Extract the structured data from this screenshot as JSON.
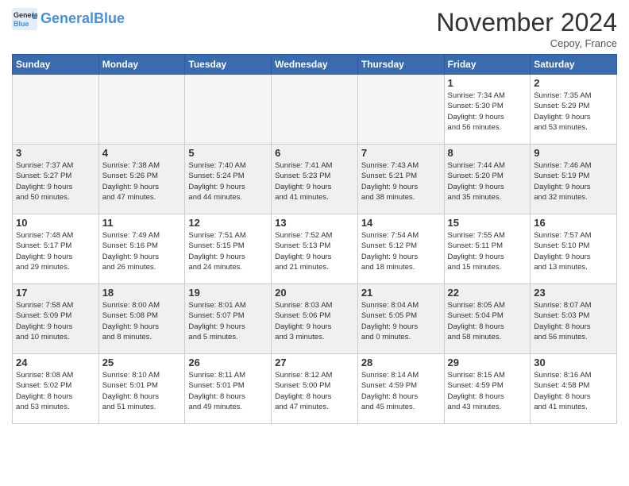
{
  "header": {
    "logo_general": "General",
    "logo_blue": "Blue",
    "month": "November 2024",
    "location": "Cepoy, France"
  },
  "weekdays": [
    "Sunday",
    "Monday",
    "Tuesday",
    "Wednesday",
    "Thursday",
    "Friday",
    "Saturday"
  ],
  "weeks": [
    [
      {
        "day": "",
        "info": ""
      },
      {
        "day": "",
        "info": ""
      },
      {
        "day": "",
        "info": ""
      },
      {
        "day": "",
        "info": ""
      },
      {
        "day": "",
        "info": ""
      },
      {
        "day": "1",
        "info": "Sunrise: 7:34 AM\nSunset: 5:30 PM\nDaylight: 9 hours\nand 56 minutes."
      },
      {
        "day": "2",
        "info": "Sunrise: 7:35 AM\nSunset: 5:29 PM\nDaylight: 9 hours\nand 53 minutes."
      }
    ],
    [
      {
        "day": "3",
        "info": "Sunrise: 7:37 AM\nSunset: 5:27 PM\nDaylight: 9 hours\nand 50 minutes."
      },
      {
        "day": "4",
        "info": "Sunrise: 7:38 AM\nSunset: 5:26 PM\nDaylight: 9 hours\nand 47 minutes."
      },
      {
        "day": "5",
        "info": "Sunrise: 7:40 AM\nSunset: 5:24 PM\nDaylight: 9 hours\nand 44 minutes."
      },
      {
        "day": "6",
        "info": "Sunrise: 7:41 AM\nSunset: 5:23 PM\nDaylight: 9 hours\nand 41 minutes."
      },
      {
        "day": "7",
        "info": "Sunrise: 7:43 AM\nSunset: 5:21 PM\nDaylight: 9 hours\nand 38 minutes."
      },
      {
        "day": "8",
        "info": "Sunrise: 7:44 AM\nSunset: 5:20 PM\nDaylight: 9 hours\nand 35 minutes."
      },
      {
        "day": "9",
        "info": "Sunrise: 7:46 AM\nSunset: 5:19 PM\nDaylight: 9 hours\nand 32 minutes."
      }
    ],
    [
      {
        "day": "10",
        "info": "Sunrise: 7:48 AM\nSunset: 5:17 PM\nDaylight: 9 hours\nand 29 minutes."
      },
      {
        "day": "11",
        "info": "Sunrise: 7:49 AM\nSunset: 5:16 PM\nDaylight: 9 hours\nand 26 minutes."
      },
      {
        "day": "12",
        "info": "Sunrise: 7:51 AM\nSunset: 5:15 PM\nDaylight: 9 hours\nand 24 minutes."
      },
      {
        "day": "13",
        "info": "Sunrise: 7:52 AM\nSunset: 5:13 PM\nDaylight: 9 hours\nand 21 minutes."
      },
      {
        "day": "14",
        "info": "Sunrise: 7:54 AM\nSunset: 5:12 PM\nDaylight: 9 hours\nand 18 minutes."
      },
      {
        "day": "15",
        "info": "Sunrise: 7:55 AM\nSunset: 5:11 PM\nDaylight: 9 hours\nand 15 minutes."
      },
      {
        "day": "16",
        "info": "Sunrise: 7:57 AM\nSunset: 5:10 PM\nDaylight: 9 hours\nand 13 minutes."
      }
    ],
    [
      {
        "day": "17",
        "info": "Sunrise: 7:58 AM\nSunset: 5:09 PM\nDaylight: 9 hours\nand 10 minutes."
      },
      {
        "day": "18",
        "info": "Sunrise: 8:00 AM\nSunset: 5:08 PM\nDaylight: 9 hours\nand 8 minutes."
      },
      {
        "day": "19",
        "info": "Sunrise: 8:01 AM\nSunset: 5:07 PM\nDaylight: 9 hours\nand 5 minutes."
      },
      {
        "day": "20",
        "info": "Sunrise: 8:03 AM\nSunset: 5:06 PM\nDaylight: 9 hours\nand 3 minutes."
      },
      {
        "day": "21",
        "info": "Sunrise: 8:04 AM\nSunset: 5:05 PM\nDaylight: 9 hours\nand 0 minutes."
      },
      {
        "day": "22",
        "info": "Sunrise: 8:05 AM\nSunset: 5:04 PM\nDaylight: 8 hours\nand 58 minutes."
      },
      {
        "day": "23",
        "info": "Sunrise: 8:07 AM\nSunset: 5:03 PM\nDaylight: 8 hours\nand 56 minutes."
      }
    ],
    [
      {
        "day": "24",
        "info": "Sunrise: 8:08 AM\nSunset: 5:02 PM\nDaylight: 8 hours\nand 53 minutes."
      },
      {
        "day": "25",
        "info": "Sunrise: 8:10 AM\nSunset: 5:01 PM\nDaylight: 8 hours\nand 51 minutes."
      },
      {
        "day": "26",
        "info": "Sunrise: 8:11 AM\nSunset: 5:01 PM\nDaylight: 8 hours\nand 49 minutes."
      },
      {
        "day": "27",
        "info": "Sunrise: 8:12 AM\nSunset: 5:00 PM\nDaylight: 8 hours\nand 47 minutes."
      },
      {
        "day": "28",
        "info": "Sunrise: 8:14 AM\nSunset: 4:59 PM\nDaylight: 8 hours\nand 45 minutes."
      },
      {
        "day": "29",
        "info": "Sunrise: 8:15 AM\nSunset: 4:59 PM\nDaylight: 8 hours\nand 43 minutes."
      },
      {
        "day": "30",
        "info": "Sunrise: 8:16 AM\nSunset: 4:58 PM\nDaylight: 8 hours\nand 41 minutes."
      }
    ]
  ]
}
